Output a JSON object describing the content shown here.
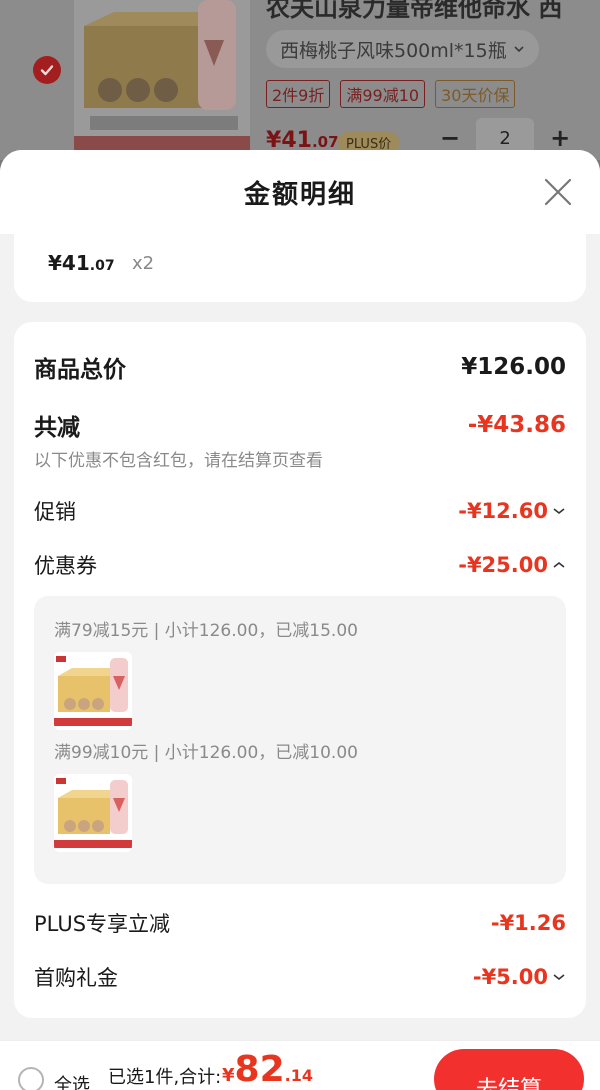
{
  "background_product": {
    "title": "农夫山泉力量帝维他命水 西",
    "sku": "西梅桃子风味500ml*15瓶",
    "tags": [
      "2件9折",
      "满99减10",
      "30天价保"
    ],
    "price_currency": "¥",
    "price_int": "41",
    "price_dec": ".07",
    "plus_label": "PLUS价",
    "minus": "−",
    "plus": "+",
    "qty": "2",
    "selected": true
  },
  "sheet": {
    "title": "金额明细",
    "item": {
      "price_currency": "¥",
      "price_int": "41",
      "price_dec": ".07",
      "qty": "x2"
    },
    "total_label": "商品总价",
    "total_value": "¥126.00",
    "discount_label": "共减",
    "discount_value": "-¥43.86",
    "discount_note": "以下优惠不包含红包，请在结算页查看",
    "promo_label": "促销",
    "promo_value": "-¥12.60",
    "coupon_label": "优惠券",
    "coupon_value": "-¥25.00",
    "coupons": [
      {
        "text": "满79减15元 | 小计126.00，已减15.00"
      },
      {
        "text": "满99减10元 | 小计126.00，已减10.00"
      }
    ],
    "plus_label": "PLUS专享立减",
    "plus_value": "-¥1.26",
    "first_label": "首购礼金",
    "first_value": "-¥5.00"
  },
  "bottom_bar": {
    "select_all": "全选",
    "summary": "已选1件,合计:",
    "total_currency": "¥",
    "total_int": "82",
    "total_dec": ".14",
    "checkout": "去结算"
  },
  "colors": {
    "accent": "#e8351f",
    "checkout": "#f2312e"
  }
}
